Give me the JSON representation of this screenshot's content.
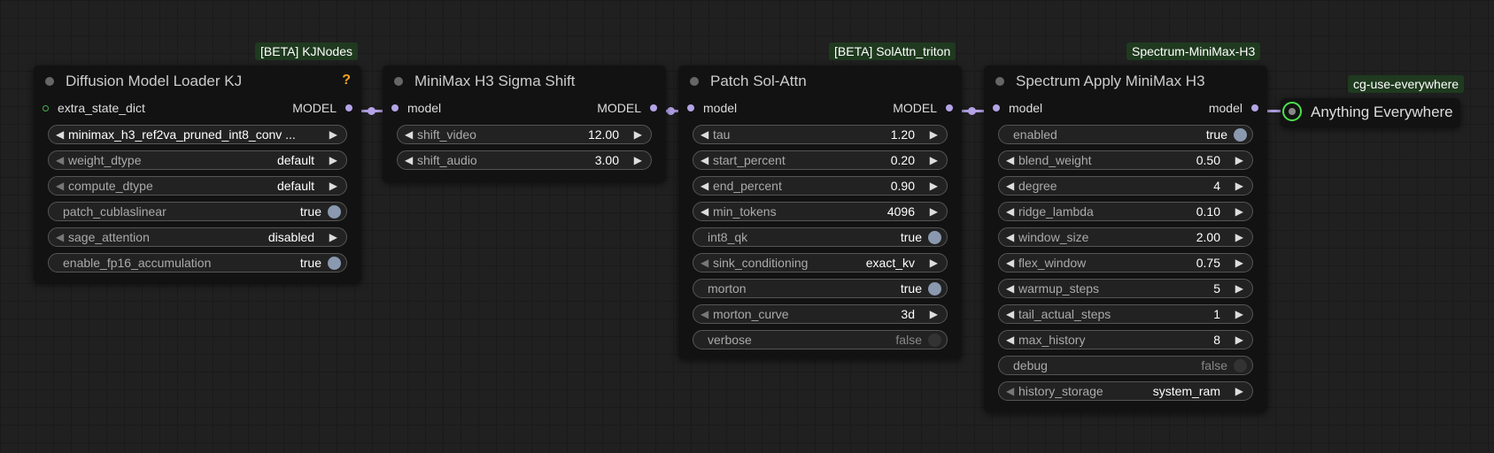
{
  "badges": {
    "kjnodes": "[BETA] KJNodes",
    "solattn": "[BETA] SolAttn_triton",
    "spectrum": "Spectrum-MiniMax-H3",
    "cg": "cg-use-everywhere"
  },
  "nodes": {
    "loader": {
      "title": "Diffusion Model Loader KJ",
      "help": "?",
      "input": "extra_state_dict",
      "output": "MODEL",
      "widgets": {
        "model_name": "minimax_h3_ref2va_pruned_int8_conv ...",
        "weight_dtype": {
          "name": "weight_dtype",
          "value": "default"
        },
        "compute_dtype": {
          "name": "compute_dtype",
          "value": "default"
        },
        "patch_cublaslinear": {
          "name": "patch_cublaslinear",
          "value": "true"
        },
        "sage_attention": {
          "name": "sage_attention",
          "value": "disabled"
        },
        "enable_fp16_accumulation": {
          "name": "enable_fp16_accumulation",
          "value": "true"
        }
      }
    },
    "sigma": {
      "title": "MiniMax H3 Sigma Shift",
      "input": "model",
      "output": "MODEL",
      "widgets": {
        "shift_video": {
          "name": "shift_video",
          "value": "12.00"
        },
        "shift_audio": {
          "name": "shift_audio",
          "value": "3.00"
        }
      }
    },
    "solattn": {
      "title": "Patch Sol-Attn",
      "input": "model",
      "output": "MODEL",
      "widgets": {
        "tau": {
          "name": "tau",
          "value": "1.20"
        },
        "start_percent": {
          "name": "start_percent",
          "value": "0.20"
        },
        "end_percent": {
          "name": "end_percent",
          "value": "0.90"
        },
        "min_tokens": {
          "name": "min_tokens",
          "value": "4096"
        },
        "int8_qk": {
          "name": "int8_qk",
          "value": "true"
        },
        "sink_conditioning": {
          "name": "sink_conditioning",
          "value": "exact_kv"
        },
        "morton": {
          "name": "morton",
          "value": "true"
        },
        "morton_curve": {
          "name": "morton_curve",
          "value": "3d"
        },
        "verbose": {
          "name": "verbose",
          "value": "false"
        }
      }
    },
    "spectrum": {
      "title": "Spectrum Apply MiniMax H3",
      "input": "model",
      "output": "model",
      "widgets": {
        "enabled": {
          "name": "enabled",
          "value": "true"
        },
        "blend_weight": {
          "name": "blend_weight",
          "value": "0.50"
        },
        "degree": {
          "name": "degree",
          "value": "4"
        },
        "ridge_lambda": {
          "name": "ridge_lambda",
          "value": "0.10"
        },
        "window_size": {
          "name": "window_size",
          "value": "2.00"
        },
        "flex_window": {
          "name": "flex_window",
          "value": "0.75"
        },
        "warmup_steps": {
          "name": "warmup_steps",
          "value": "5"
        },
        "tail_actual_steps": {
          "name": "tail_actual_steps",
          "value": "1"
        },
        "max_history": {
          "name": "max_history",
          "value": "8"
        },
        "debug": {
          "name": "debug",
          "value": "false"
        },
        "history_storage": {
          "name": "history_storage",
          "value": "system_ram"
        }
      }
    },
    "anything": {
      "title": "Anything Everywhere"
    }
  },
  "glyphs": {
    "left": "◀",
    "right": "▶"
  },
  "colors": {
    "background": "#202020",
    "node_body": "#121212",
    "model_link": "#b4a3e6",
    "badge_bg": "#1f3a1f",
    "help": "#f0a020",
    "toggle_on": "#8a99b0",
    "anything_ring": "#4ce04c"
  }
}
